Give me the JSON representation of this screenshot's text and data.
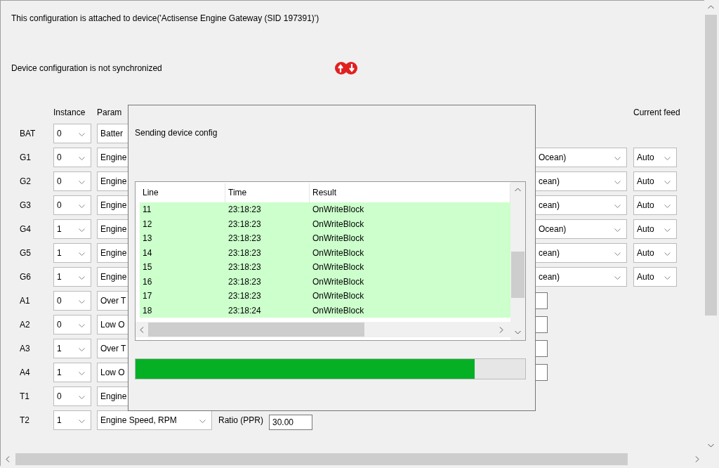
{
  "header": {
    "attached_text": "This configuration is attached to device('Actisense Engine Gateway (SID 197391)')",
    "sync_text": "Device configuration is not synchronized"
  },
  "columns": {
    "instance": "Instance",
    "parameter": "Param",
    "current_feed": "Current feed"
  },
  "rows": [
    {
      "label": "BAT",
      "instance": "0",
      "parameter": "Batter",
      "kind": "none"
    },
    {
      "label": "G1",
      "instance": "0",
      "parameter": "Engine",
      "kind": "source",
      "source": "Ocean)",
      "feed": "Auto"
    },
    {
      "label": "G2",
      "instance": "0",
      "parameter": "Engine",
      "kind": "source",
      "source": "cean)",
      "feed": "Auto"
    },
    {
      "label": "G3",
      "instance": "0",
      "parameter": "Engine",
      "kind": "source",
      "source": "cean)",
      "feed": "Auto"
    },
    {
      "label": "G4",
      "instance": "1",
      "parameter": "Engine",
      "kind": "source",
      "source": "Ocean)",
      "feed": "Auto"
    },
    {
      "label": "G5",
      "instance": "1",
      "parameter": "Engine",
      "kind": "source",
      "source": "cean)",
      "feed": "Auto"
    },
    {
      "label": "G6",
      "instance": "1",
      "parameter": "Engine",
      "kind": "source",
      "source": "cean)",
      "feed": "Auto"
    },
    {
      "label": "A1",
      "instance": "0",
      "parameter": "Over T",
      "kind": "input"
    },
    {
      "label": "A2",
      "instance": "0",
      "parameter": "Low O",
      "kind": "input"
    },
    {
      "label": "A3",
      "instance": "1",
      "parameter": "Over T",
      "kind": "input"
    },
    {
      "label": "A4",
      "instance": "1",
      "parameter": "Low O",
      "kind": "input"
    },
    {
      "label": "T1",
      "instance": "0",
      "parameter": "Engine",
      "kind": "none"
    },
    {
      "label": "T2",
      "instance": "1",
      "parameter": "Engine Speed, RPM",
      "kind": "ratio",
      "ratio_label": "Ratio (PPR)",
      "ratio_value": "30.00"
    }
  ],
  "dialog": {
    "title": "Sending device config",
    "columns": [
      "Line",
      "Time",
      "Result"
    ],
    "log": [
      {
        "line": "11",
        "time": "23:18:23",
        "result": "OnWriteBlock"
      },
      {
        "line": "12",
        "time": "23:18:23",
        "result": "OnWriteBlock"
      },
      {
        "line": "13",
        "time": "23:18:23",
        "result": "OnWriteBlock"
      },
      {
        "line": "14",
        "time": "23:18:23",
        "result": "OnWriteBlock"
      },
      {
        "line": "15",
        "time": "23:18:23",
        "result": "OnWriteBlock"
      },
      {
        "line": "16",
        "time": "23:18:23",
        "result": "OnWriteBlock"
      },
      {
        "line": "17",
        "time": "23:18:23",
        "result": "OnWriteBlock"
      },
      {
        "line": "18",
        "time": "23:18:24",
        "result": "OnWriteBlock"
      }
    ],
    "progress": {
      "level": 0.87
    }
  }
}
